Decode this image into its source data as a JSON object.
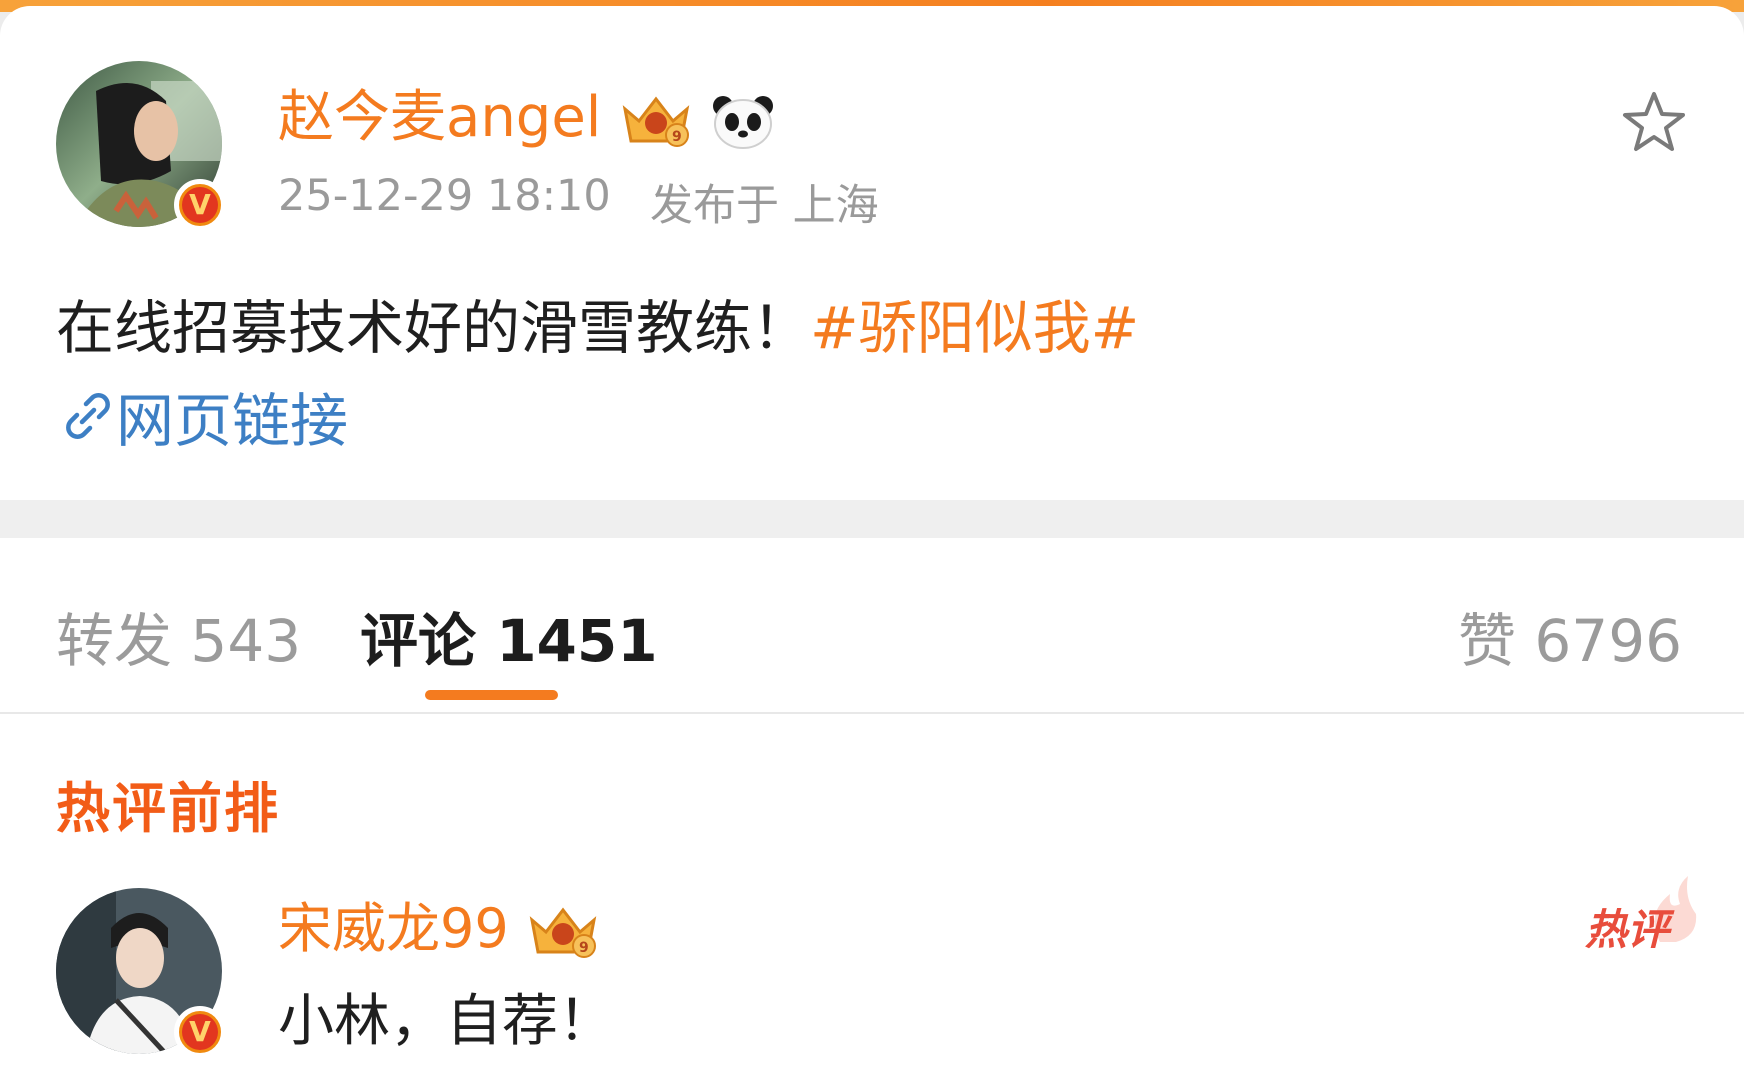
{
  "post": {
    "author": "赵今麦angel",
    "time": "25-12-29 18:10",
    "location": "发布于 上海",
    "body_text": "在线招募技术好的滑雪教练！",
    "hashtag": "#骄阳似我#",
    "link_label": "网页链接"
  },
  "tabs": {
    "repost": "转发 543",
    "comment": "评论 1451",
    "like": "赞 6796"
  },
  "comments": {
    "section_title": "热评前排",
    "hot_tag": "热评",
    "items": [
      {
        "author": "宋威龙99",
        "text": "小林，自荐！"
      }
    ]
  },
  "colors": {
    "accent": "#f47b1f",
    "link": "#3d7fc4",
    "muted": "#9a9a9a",
    "hot": "#e84d3c"
  }
}
